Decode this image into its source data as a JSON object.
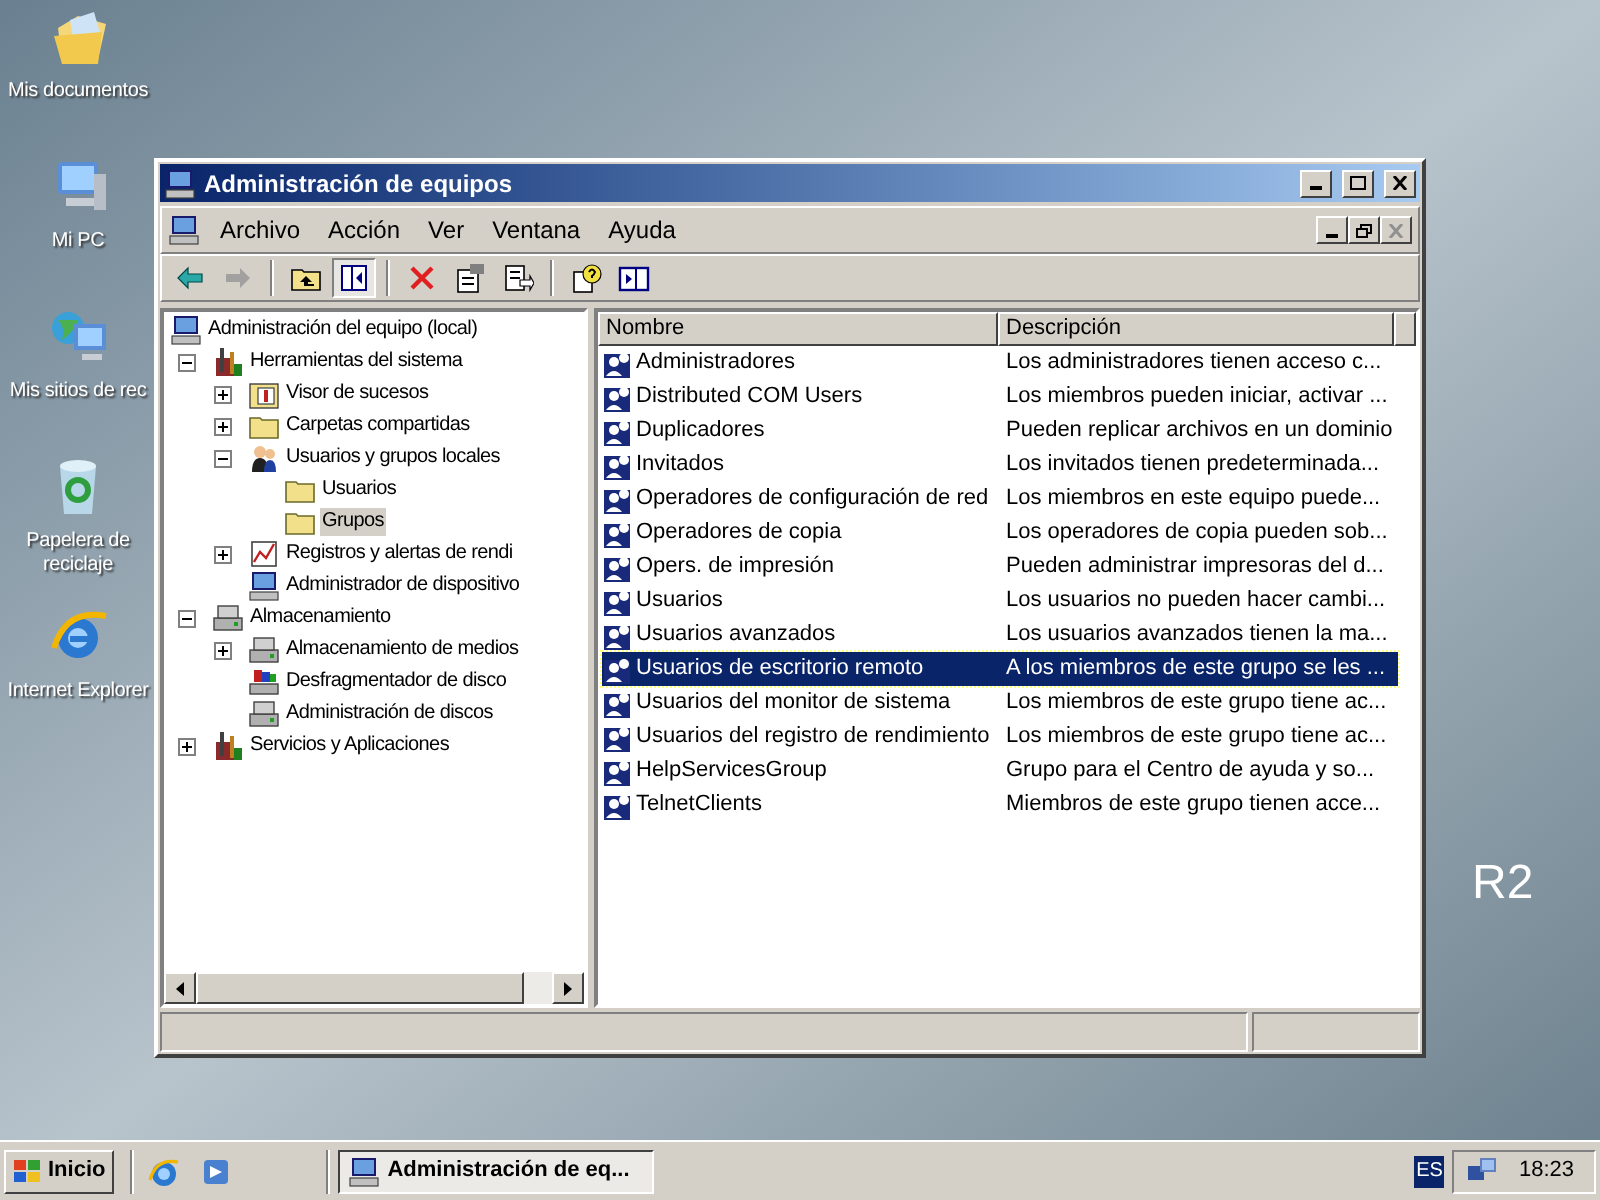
{
  "desktop": {
    "icons": [
      {
        "label": "Mis documentos",
        "kind": "documents"
      },
      {
        "label": "Mi PC",
        "kind": "computer"
      },
      {
        "label": "Mis sitios de rec",
        "kind": "network"
      },
      {
        "label": "Papelera de reciclaje",
        "kind": "recycle"
      },
      {
        "label": "Internet Explorer",
        "kind": "browser"
      }
    ],
    "background_text": "R2"
  },
  "window": {
    "title": "Administración de equipos",
    "menu": [
      "Archivo",
      "Acción",
      "Ver",
      "Ventana",
      "Ayuda"
    ],
    "toolbar": [
      {
        "kind": "back",
        "disabled": false,
        "pressed": false
      },
      {
        "kind": "forward",
        "disabled": true,
        "pressed": false
      },
      {
        "kind": "sep"
      },
      {
        "kind": "up",
        "disabled": false,
        "pressed": false
      },
      {
        "kind": "tree",
        "disabled": false,
        "pressed": true
      },
      {
        "kind": "sep"
      },
      {
        "kind": "delete",
        "disabled": false,
        "pressed": false
      },
      {
        "kind": "properties",
        "disabled": false,
        "pressed": false
      },
      {
        "kind": "export",
        "disabled": false,
        "pressed": false
      },
      {
        "kind": "sep"
      },
      {
        "kind": "help",
        "disabled": false,
        "pressed": false
      },
      {
        "kind": "pane",
        "disabled": false,
        "pressed": false
      }
    ],
    "tree": [
      {
        "label": "Administración del equipo (local)",
        "kind": "computer",
        "selected": false,
        "children": [
          {
            "label": "Herramientas del sistema",
            "kind": "tools",
            "expanded": true,
            "selected": false,
            "children": [
              {
                "label": "Visor de sucesos",
                "kind": "event",
                "expanded": false,
                "selected": false
              },
              {
                "label": "Carpetas compartidas",
                "kind": "folder",
                "expanded": false,
                "selected": false
              },
              {
                "label": "Usuarios y grupos locales",
                "kind": "users",
                "expanded": true,
                "selected": false,
                "children": [
                  {
                    "label": "Usuarios",
                    "kind": "folder",
                    "selected": false
                  },
                  {
                    "label": "Grupos",
                    "kind": "folder",
                    "selected": true
                  }
                ]
              },
              {
                "label": "Registros y alertas de rendi",
                "kind": "chart",
                "expanded": false,
                "selected": false
              },
              {
                "label": "Administrador de dispositivo",
                "kind": "computer",
                "selected": false
              }
            ]
          },
          {
            "label": "Almacenamiento",
            "kind": "storage",
            "expanded": true,
            "selected": false,
            "children": [
              {
                "label": "Almacenamiento de medios",
                "kind": "storage",
                "expanded": false,
                "selected": false
              },
              {
                "label": "Desfragmentador de disco",
                "kind": "defrag",
                "selected": false
              },
              {
                "label": "Administración de discos",
                "kind": "storage",
                "selected": false
              }
            ]
          },
          {
            "label": "Servicios y Aplicaciones",
            "kind": "tools",
            "expanded": false,
            "selected": false
          }
        ]
      }
    ],
    "list": {
      "columns": [
        "Nombre",
        "Descripción"
      ],
      "rows": [
        {
          "name": "Administradores",
          "description": "Los administradores tienen acceso c...",
          "selected": false
        },
        {
          "name": "Distributed COM Users",
          "description": "Los miembros pueden iniciar, activar ...",
          "selected": false
        },
        {
          "name": "Duplicadores",
          "description": "Pueden replicar archivos en un dominio",
          "selected": false
        },
        {
          "name": "Invitados",
          "description": "Los invitados tienen predeterminada...",
          "selected": false
        },
        {
          "name": "Operadores de configuración de red",
          "description": "Los miembros en este equipo puede...",
          "selected": false
        },
        {
          "name": "Operadores de copia",
          "description": "Los operadores de copia pueden sob...",
          "selected": false
        },
        {
          "name": "Opers. de impresión",
          "description": "Pueden administrar impresoras del d...",
          "selected": false
        },
        {
          "name": "Usuarios",
          "description": "Los usuarios no pueden hacer cambi...",
          "selected": false
        },
        {
          "name": "Usuarios avanzados",
          "description": "Los usuarios avanzados tienen la ma...",
          "selected": false
        },
        {
          "name": "Usuarios de escritorio remoto",
          "description": "A los miembros de este grupo se les ...",
          "selected": true
        },
        {
          "name": "Usuarios del monitor de sistema",
          "description": "Los miembros de este grupo tiene ac...",
          "selected": false
        },
        {
          "name": "Usuarios del registro de rendimiento",
          "description": "Los miembros de este grupo tiene ac...",
          "selected": false
        },
        {
          "name": "HelpServicesGroup",
          "description": "Grupo para el Centro de ayuda y so...",
          "selected": false
        },
        {
          "name": "TelnetClients",
          "description": "Miembros de este grupo tienen acce...",
          "selected": false
        }
      ]
    }
  },
  "taskbar": {
    "start": "Inicio",
    "quick_launch": [
      {
        "kind": "browser"
      },
      {
        "kind": "desktop"
      }
    ],
    "tasks": [
      {
        "label": "Administración de eq...",
        "selected": true
      }
    ],
    "language": "ES",
    "clock": "18:23"
  }
}
